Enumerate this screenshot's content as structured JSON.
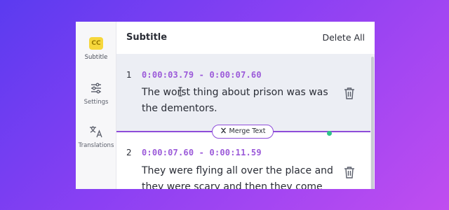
{
  "sidebar": {
    "items": [
      {
        "label": "Subtitle",
        "icon": "cc-icon",
        "glyph": "CC",
        "active": true
      },
      {
        "label": "Settings",
        "icon": "sliders-icon"
      },
      {
        "label": "Translations",
        "icon": "translate-icon"
      }
    ]
  },
  "header": {
    "title": "Subtitle",
    "delete_all_label": "Delete All"
  },
  "subtitles": [
    {
      "index": "1",
      "time": "0:00:03.79 - 0:00:07.60",
      "text": "The worst thing about prison was was the dementors."
    },
    {
      "index": "2",
      "time": "0:00:07.60 - 0:00:11.59",
      "text": "They were flying all over the place and they were scary and then they come"
    }
  ],
  "merge_label": "Merge Text",
  "colors": {
    "accent": "#8e4cd9",
    "time": "#9b5ad9",
    "status_dot": "#2dc58a",
    "cc_badge": "#f6d73c"
  }
}
